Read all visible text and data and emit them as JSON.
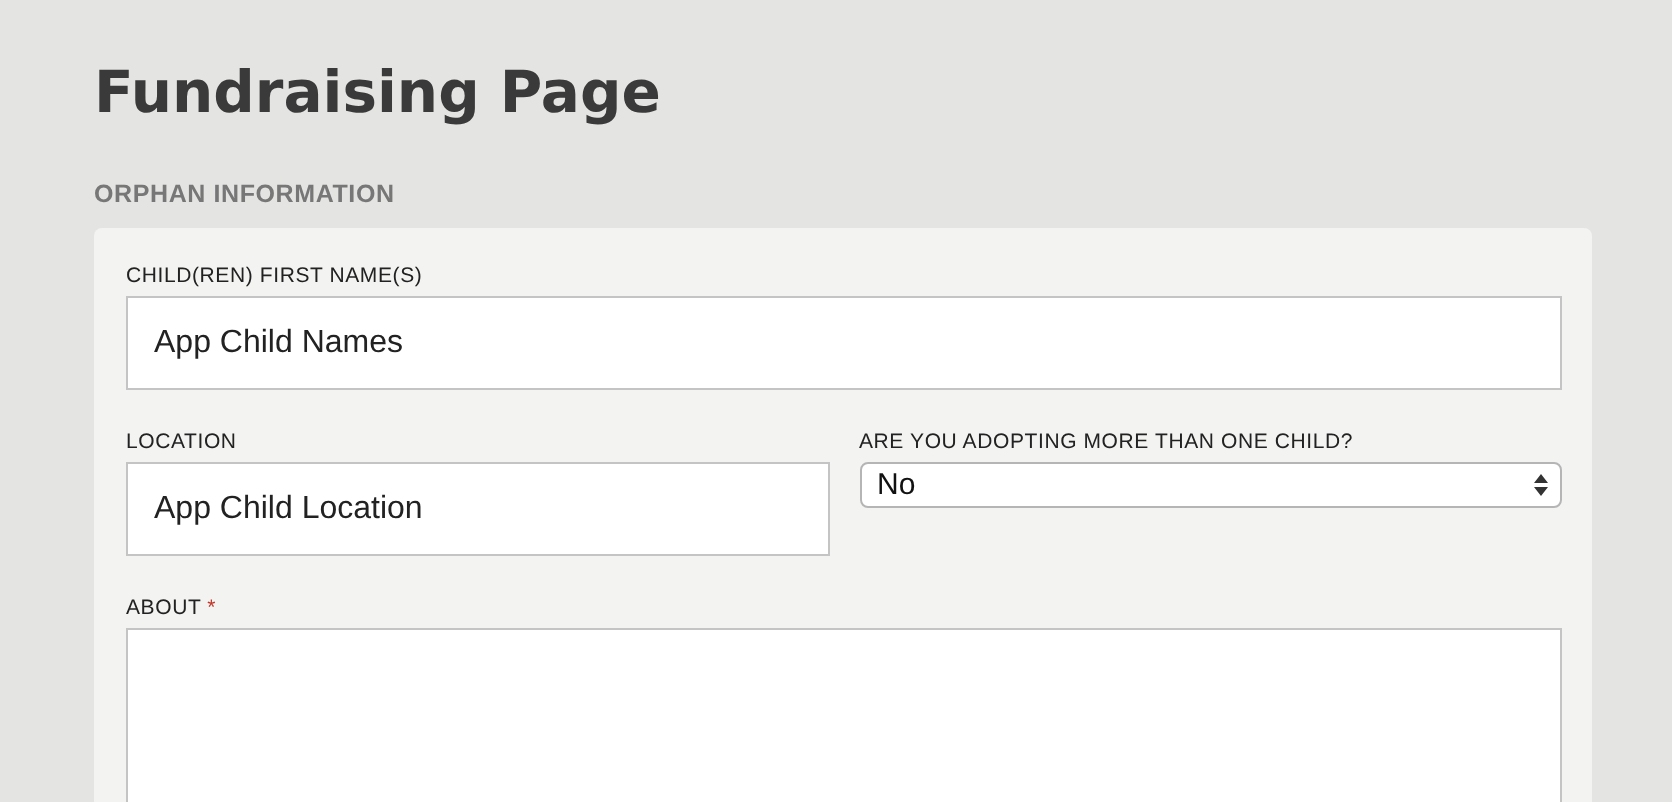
{
  "page_title": "Fundraising Page",
  "section": {
    "title": "ORPHAN INFORMATION",
    "rows": [
      [
        {
          "kind": "text",
          "label": "CHILD(REN) FIRST NAME(S)",
          "value": "App Child Names"
        }
      ],
      [
        {
          "kind": "text",
          "label": "LOCATION",
          "value": "App Child Location"
        },
        {
          "kind": "select",
          "label": "ARE YOU ADOPTING MORE THAN ONE CHILD?",
          "value": "No"
        }
      ],
      [
        {
          "kind": "textarea",
          "label": "ABOUT",
          "required_mark": "*"
        }
      ]
    ]
  }
}
